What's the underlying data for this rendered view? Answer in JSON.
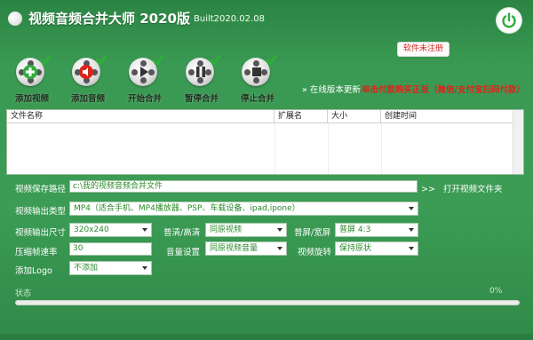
{
  "app": {
    "title": "视频音频合并大师 2020版",
    "build": "Built2020.02.08",
    "register_label": "软件未注册"
  },
  "toolbar": [
    {
      "label": "添加视频",
      "icon": "add-video-icon"
    },
    {
      "label": "添加音频",
      "icon": "add-audio-icon"
    },
    {
      "label": "开始合并",
      "icon": "start-merge-icon"
    },
    {
      "label": "暂停合并",
      "icon": "pause-merge-icon"
    },
    {
      "label": "停止合并",
      "icon": "stop-merge-icon"
    }
  ],
  "promo": {
    "online_update": "» 在线版本更新",
    "buy": "单击付款购买正版（微信/支付宝扫码付款）"
  },
  "file_table": {
    "columns": [
      "文件名称",
      "扩展名",
      "大小",
      "创建时间"
    ],
    "rows": []
  },
  "form": {
    "save_path_label": "视频保存路径",
    "save_path_value": "c:\\我的视频音频合并文件",
    "open_folder_arrow": ">>",
    "open_folder_label": "打开视频文件夹",
    "output_type_label": "视频输出类型",
    "output_type_value": "MP4（适合手机、MP4播放器、PSP、车载设备、ipad,ipone）",
    "output_size_label": "视频输出尺寸",
    "output_size_value": "320x240",
    "quality_label": "普清/高清",
    "quality_value": "同原视频",
    "aspect_label": "普屏/宽屏",
    "aspect_value": "普屏 4:3",
    "framerate_label": "压缩帧速率",
    "framerate_value": "30",
    "volume_label": "音量设置",
    "volume_value": "同原视频音量",
    "rotate_label": "视频旋转",
    "rotate_value": "保持原状",
    "logo_label": "添加Logo",
    "logo_value": "不添加"
  },
  "status": {
    "label": "状态",
    "percent": "0%",
    "progress": 0
  },
  "colors": {
    "background": "#3a9a53",
    "accent_red": "#d9261c",
    "value_green": "#2c8a2c"
  }
}
